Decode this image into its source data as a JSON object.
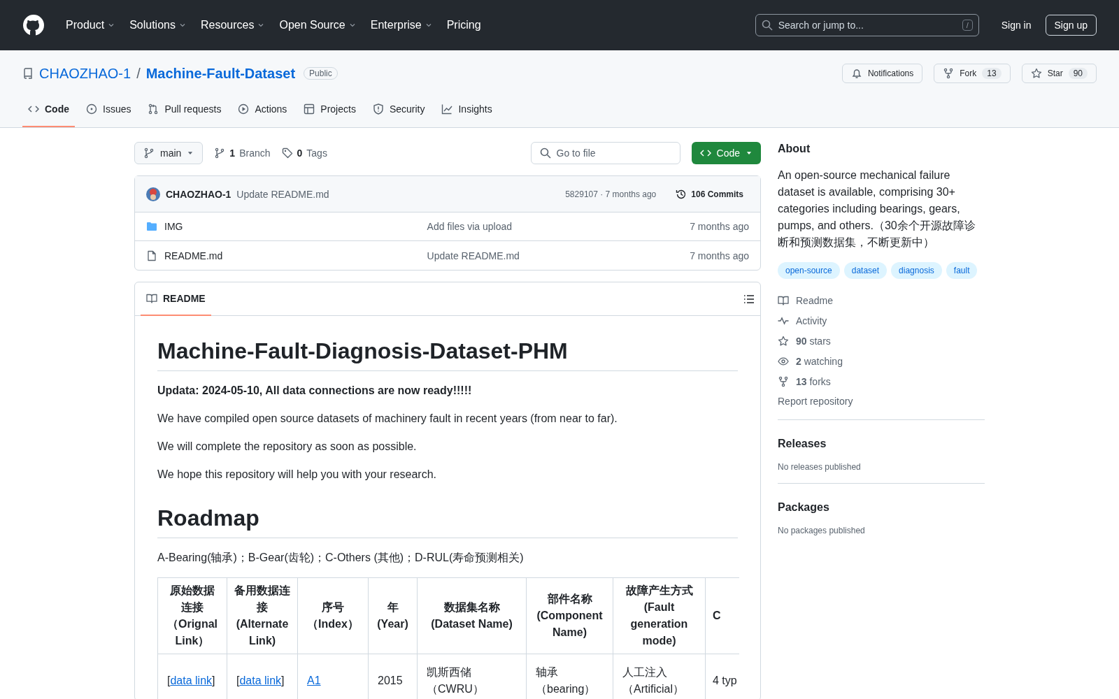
{
  "nav": {
    "items": [
      {
        "label": "Product",
        "has_menu": true
      },
      {
        "label": "Solutions",
        "has_menu": true
      },
      {
        "label": "Resources",
        "has_menu": true
      },
      {
        "label": "Open Source",
        "has_menu": true
      },
      {
        "label": "Enterprise",
        "has_menu": true
      },
      {
        "label": "Pricing",
        "has_menu": false
      }
    ],
    "search": {
      "placeholder": "Search or jump to...",
      "shortcut": "/"
    },
    "sign_in": "Sign in",
    "sign_up": "Sign up"
  },
  "repo": {
    "owner": "CHAOZHAO-1",
    "separator": "/",
    "name": "Machine-Fault-Dataset",
    "visibility": "Public",
    "notifications": "Notifications",
    "fork": {
      "label": "Fork",
      "count": "13"
    },
    "star": {
      "label": "Star",
      "count": "90"
    }
  },
  "tabs": [
    {
      "label": "Code",
      "selected": true
    },
    {
      "label": "Issues",
      "selected": false
    },
    {
      "label": "Pull requests",
      "selected": false
    },
    {
      "label": "Actions",
      "selected": false
    },
    {
      "label": "Projects",
      "selected": false
    },
    {
      "label": "Security",
      "selected": false
    },
    {
      "label": "Insights",
      "selected": false
    }
  ],
  "files": {
    "branch": "main",
    "branches": {
      "count": "1",
      "label": "Branch"
    },
    "tags": {
      "count": "0",
      "label": "Tags"
    },
    "go_to_file": {
      "placeholder": "Go to file"
    },
    "code_button": "Code",
    "commit": {
      "author": "CHAOZHAO-1",
      "message": "Update README.md",
      "hash": "5829107 · 7 months ago",
      "commits": "106 Commits"
    },
    "rows": [
      {
        "kind": "folder",
        "name": "IMG",
        "message": "Add files via upload",
        "time": "7 months ago"
      },
      {
        "kind": "file",
        "name": "README.md",
        "message": "Update README.md",
        "time": "7 months ago"
      }
    ]
  },
  "readme": {
    "tab": "README",
    "title": "Machine-Fault-Diagnosis-Dataset-PHM",
    "paragraphs": [
      {
        "kind": "strong",
        "text": "Updata: 2024-05-10, All data connections are now ready!!!!!"
      },
      {
        "kind": "plain",
        "text": "We have compiled open source datasets of machinery fault in recent years (from near to far)."
      },
      {
        "kind": "plain",
        "text": "We will complete the repository as soon as possible."
      },
      {
        "kind": "plain",
        "text": "We hope this repository will help you with your research."
      }
    ],
    "heading": "Roadmap",
    "legend": "A-Bearing(轴承)；B-Gear(齿轮)；C-Others (其他)；D-RUL(寿命预测相关)",
    "table": {
      "columns": [
        "原始数据连接（Orignal Link）",
        "备用数据连接(Alternate Link)",
        "序号（Index）",
        "年(Year)",
        "数据集名称(Dataset Name)",
        "部件名称(Component Name)",
        "故障产生方式(Fault generation mode)",
        "C"
      ],
      "rows": [
        [
          {
            "before": "[",
            "link": "data link",
            "after": "]"
          },
          {
            "before": "[",
            "link": "data link",
            "after": "]"
          },
          {
            "link": "A1"
          },
          {
            "text": "2015"
          },
          {
            "text": "凯斯西储（CWRU）"
          },
          {
            "text": "轴承（bearing）"
          },
          {
            "text": "人工注入（Artificial）"
          },
          {
            "text": "4 typ"
          }
        ]
      ]
    }
  },
  "about": {
    "title": "About",
    "description": "An open-source mechanical failure dataset is available, comprising 30+ categories including bearings, gears, pumps, and others.（30余个开源故障诊断和预测数据集，不断更新中）",
    "topics": [
      "open-source",
      "dataset",
      "diagnosis",
      "fault"
    ],
    "links": [
      "Readme",
      "Activity",
      "**90** stars",
      "**2** watching",
      "**13** forks"
    ],
    "report": "Report repository"
  },
  "releases": {
    "title": "Releases",
    "note": "No releases published"
  },
  "packages": {
    "title": "Packages",
    "note": "No packages published"
  }
}
